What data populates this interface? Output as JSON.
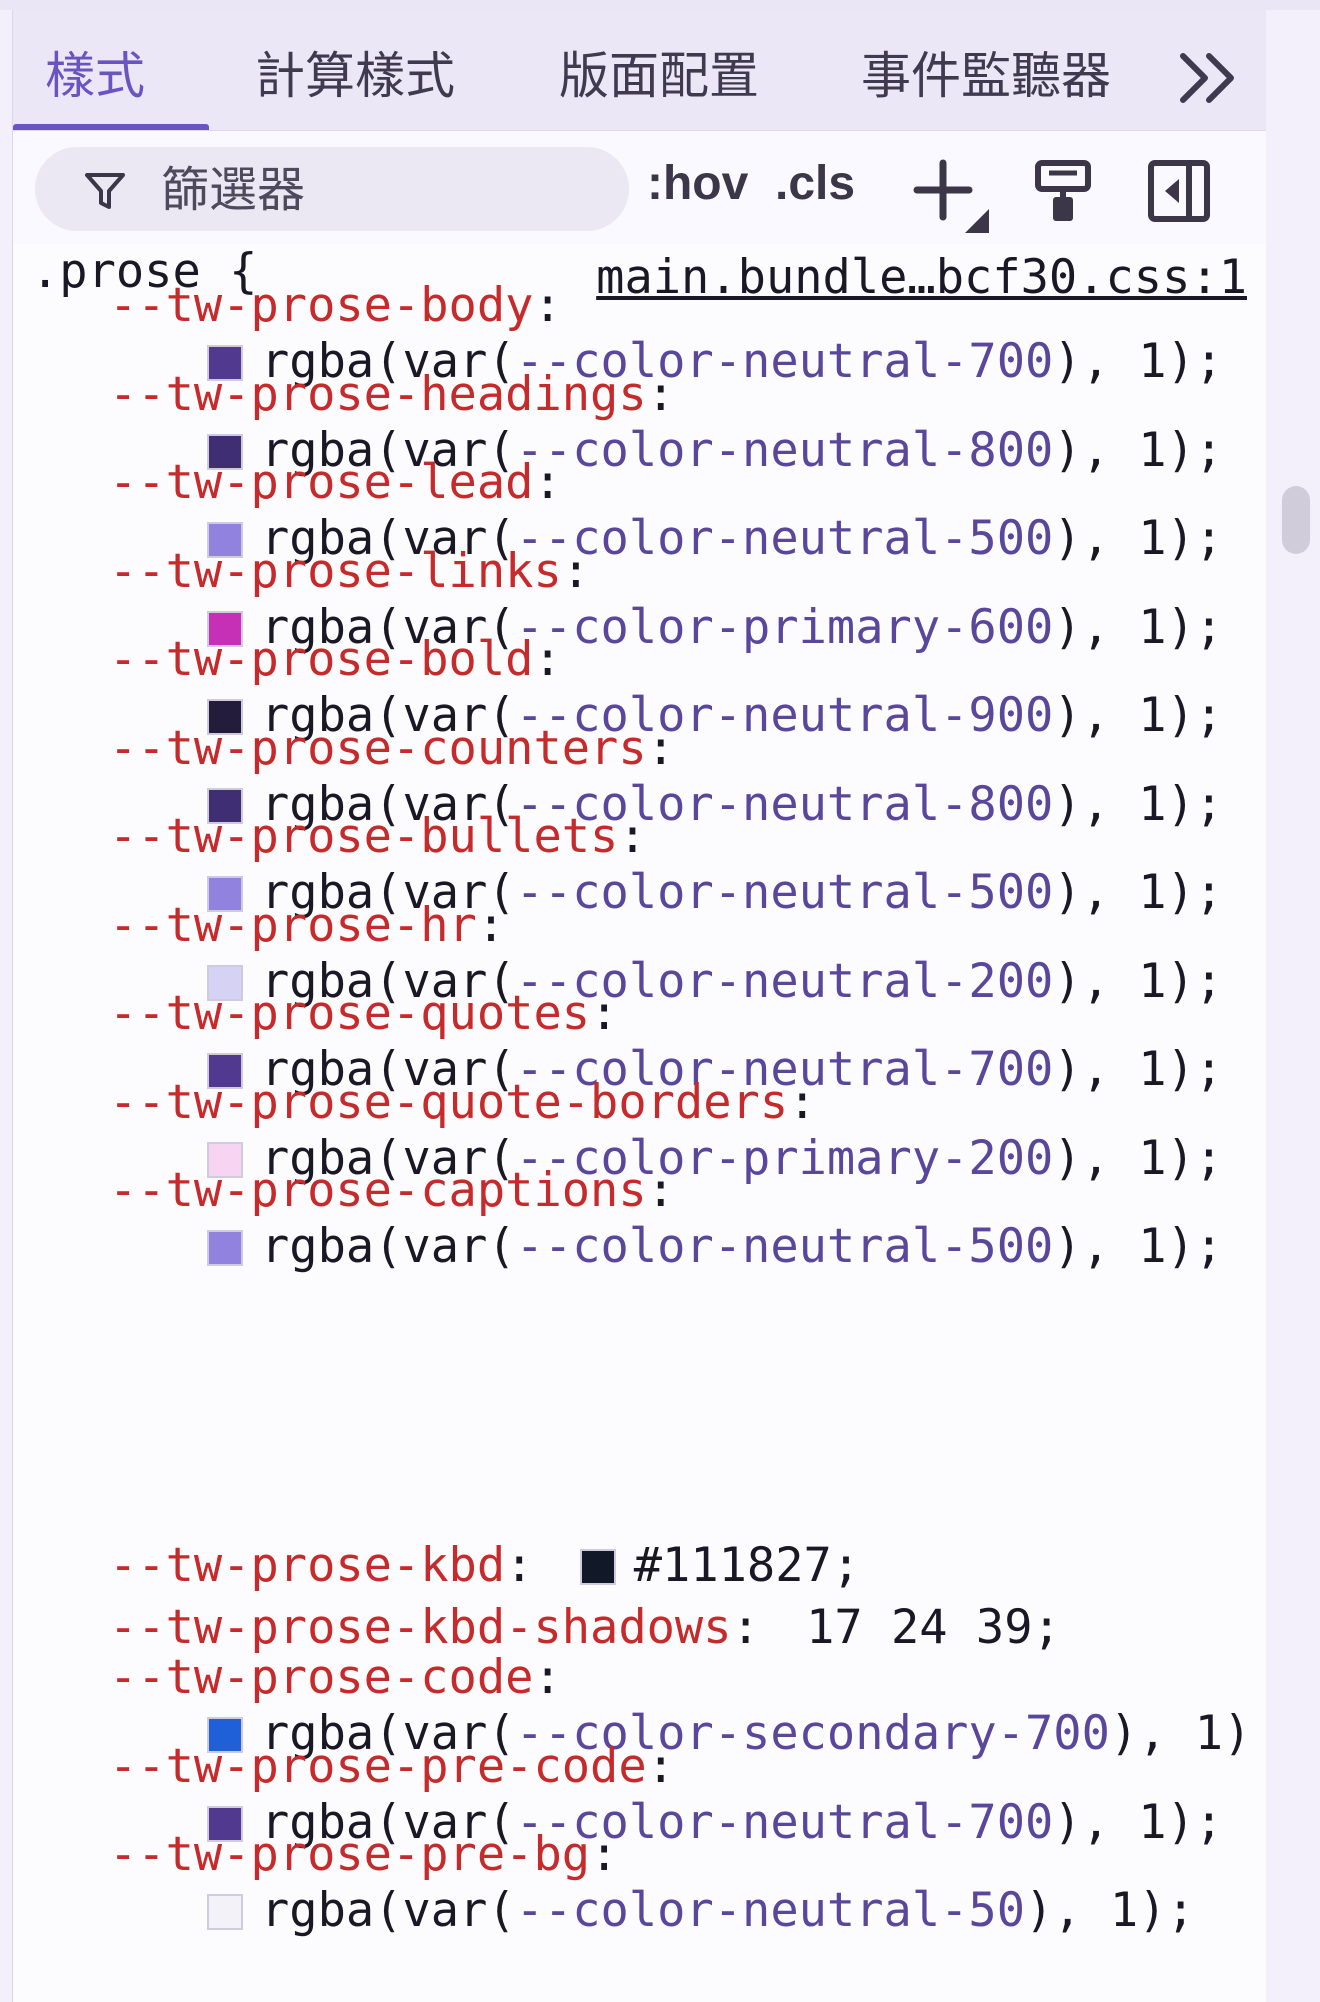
{
  "tabs": [
    {
      "label": "樣式",
      "active": true
    },
    {
      "label": "計算樣式",
      "active": false
    },
    {
      "label": "版面配置",
      "active": false
    },
    {
      "label": "事件監聽器",
      "active": false
    }
  ],
  "toolbar": {
    "filter_placeholder": "篩選器",
    "hov_label": ":hov",
    "cls_label": ".cls"
  },
  "rule": {
    "selector": ".prose {",
    "source": "main.bundle…bcf30.css:1",
    "declarations": [
      {
        "prop": "--tw-prose-body",
        "sep": ":",
        "swatch": "#51398f",
        "pre": "rgba(var(",
        "var": "--color-neutral-700",
        "post": "), 1);"
      },
      {
        "prop": "--tw-prose-headings",
        "sep": ":",
        "swatch": "#3f2f72",
        "pre": "rgba(var(",
        "var": "--color-neutral-800",
        "post": "), 1);"
      },
      {
        "prop": "--tw-prose-lead",
        "sep": ":",
        "swatch": "#9182dd",
        "pre": "rgba(var(",
        "var": "--color-neutral-500",
        "post": "), 1);"
      },
      {
        "prop": "--tw-prose-links",
        "sep": ":",
        "swatch": "#c530b7",
        "pre": "rgba(var(",
        "var": "--color-primary-600",
        "post": "), 1);"
      },
      {
        "prop": "--tw-prose-bold",
        "sep": ":",
        "swatch": "#231c3a",
        "pre": "rgba(var(",
        "var": "--color-neutral-900",
        "post": "), 1);"
      },
      {
        "prop": "--tw-prose-counters",
        "sep": ":",
        "swatch": "#3f2f72",
        "pre": "rgba(var(",
        "var": "--color-neutral-800",
        "post": "), 1);"
      },
      {
        "prop": "--tw-prose-bullets",
        "sep": ":",
        "swatch": "#9182dd",
        "pre": "rgba(var(",
        "var": "--color-neutral-500",
        "post": "), 1);"
      },
      {
        "prop": "--tw-prose-hr",
        "sep": ":",
        "swatch": "#d6d2f3",
        "pre": "rgba(var(",
        "var": "--color-neutral-200",
        "post": "), 1);"
      },
      {
        "prop": "--tw-prose-quotes",
        "sep": ":",
        "swatch": "#51398f",
        "pre": "rgba(var(",
        "var": "--color-neutral-700",
        "post": "), 1);"
      },
      {
        "prop": "--tw-prose-quote-borders",
        "sep": ":",
        "swatch": "#f7d4f1",
        "pre": "rgba(var(",
        "var": "--color-primary-200",
        "post": "), 1);"
      },
      {
        "prop": "--tw-prose-captions",
        "sep": ":",
        "swatch": "#9182dd",
        "pre": "rgba(var(",
        "var": "--color-neutral-500",
        "post": "), 1);"
      }
    ],
    "kbd": {
      "prop": "--tw-prose-kbd",
      "sep": ":",
      "swatch": "#111827",
      "value": "#111827;"
    },
    "kbd_shadows": {
      "prop": "--tw-prose-kbd-shadows",
      "sep": ":",
      "value": "17 24 39;"
    },
    "declarations2": [
      {
        "prop": "--tw-prose-code",
        "sep": ":",
        "swatch": "#1f5fd8",
        "pre": "rgba(var(",
        "var": "--color-secondary-700",
        "post": "), 1)"
      },
      {
        "prop": "--tw-prose-pre-code",
        "sep": ":",
        "swatch": "#51398f",
        "pre": "rgba(var(",
        "var": "--color-neutral-700",
        "post": "), 1);"
      },
      {
        "prop": "--tw-prose-pre-bg",
        "sep": ":",
        "swatch": "#f3f2f8",
        "pre": "rgba(var(",
        "var": "--color-neutral-50",
        "post": "), 1);"
      }
    ]
  }
}
